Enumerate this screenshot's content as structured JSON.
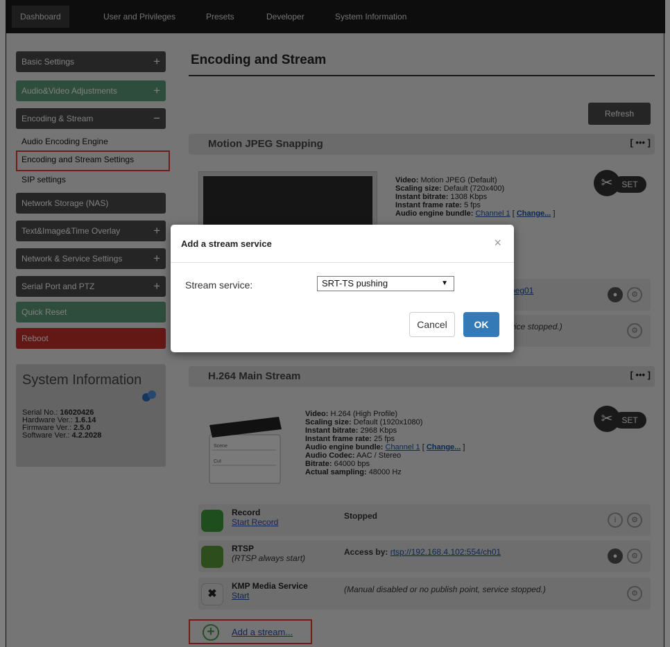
{
  "topnav": {
    "tabs": [
      "Dashboard",
      "User and Privileges",
      "Presets",
      "Developer",
      "System Information"
    ]
  },
  "sidebar": {
    "basic": "Basic Settings",
    "av": "Audio&Video Adjustments",
    "enc": "Encoding & Stream",
    "sub": [
      "Audio Encoding Engine",
      "Encoding and Stream Settings",
      "SIP settings"
    ],
    "nas": "Network Storage (NAS)",
    "overlay": "Text&Image&Time Overlay",
    "netsvc": "Network & Service Settings",
    "serial": "Serial Port and PTZ",
    "quick": "Quick Reset",
    "reboot": "Reboot",
    "plus": "+",
    "minus": "−"
  },
  "sysinfo": {
    "title": "System Information",
    "serial_k": "Serial No.: ",
    "serial_v": "16020426",
    "hw_k": "Hardware Ver.: ",
    "hw_v": "1.6.14",
    "fw_k": "Firmware Ver.: ",
    "fw_v": "2.5.0",
    "sw_k": "Software Ver.: ",
    "sw_v": "4.2.2028"
  },
  "main": {
    "title": "Encoding and Stream",
    "refresh": "Refresh",
    "more": "[ ••• ]",
    "set": "SET"
  },
  "mjpeg": {
    "header": "Motion JPEG Snapping",
    "video_k": "Video:",
    "video_v": "Motion JPEG (Default)",
    "scale_k": "Scaling size:",
    "scale_v": "Default (720x400)",
    "bitrate_k": "Instant bitrate:",
    "bitrate_v": "1308 Kbps",
    "frame_k": "Instant frame rate:",
    "frame_v": "5 fps",
    "audio_k": "Audio engine bundle:",
    "audio_v": "Channel 1",
    "change": "Change...",
    "rtsp_link": "peg01",
    "stopped_tail": "vice stopped.)"
  },
  "h264": {
    "header": "H.264 Main Stream",
    "video_k": "Video:",
    "video_v": "H.264 (High Profile)",
    "scale_k": "Scaling size:",
    "scale_v": "Default (1920x1080)",
    "bitrate_k": "Instant bitrate:",
    "bitrate_v": "2968 Kbps",
    "frame_k": "Instant frame rate:",
    "frame_v": "25 fps",
    "audio_k": "Audio engine bundle:",
    "audio_v": "Channel 1",
    "change": "Change...",
    "codec_k": "Audio Codec:",
    "codec_v": "AAC / Stereo",
    "br_k": "Bitrate:",
    "br_v": "64000 bps",
    "samp_k": "Actual sampling:",
    "samp_v": "48000 Hz",
    "clap_scene": "Scene",
    "clap_cut": "Cut"
  },
  "rows": {
    "record_name": "Record",
    "record_sub": "Start Record",
    "record_status": "Stopped",
    "rtsp_name": "RTSP",
    "rtsp_sub": "(RTSP always start)",
    "rtsp_status_k": "Access by:",
    "rtsp_status_v": "rtsp://192.168.4.102:554/ch01",
    "kmp_name": "KMP Media Service",
    "kmp_sub": "Start",
    "kmp_status": "(Manual disabled or no publish point, service stopped.)"
  },
  "add_stream": "Add a stream...",
  "modal": {
    "title": "Add a stream service",
    "close": "×",
    "label": "Stream service:",
    "selected": "SRT-TS pushing",
    "cancel": "Cancel",
    "ok": "OK"
  },
  "colors": {
    "accent_red": "#e53935",
    "primary_blue": "#337ab7",
    "sidebar_dark": "#4a4a4a",
    "sidebar_green": "#5e9a7a",
    "reboot_red": "#c9302c"
  }
}
